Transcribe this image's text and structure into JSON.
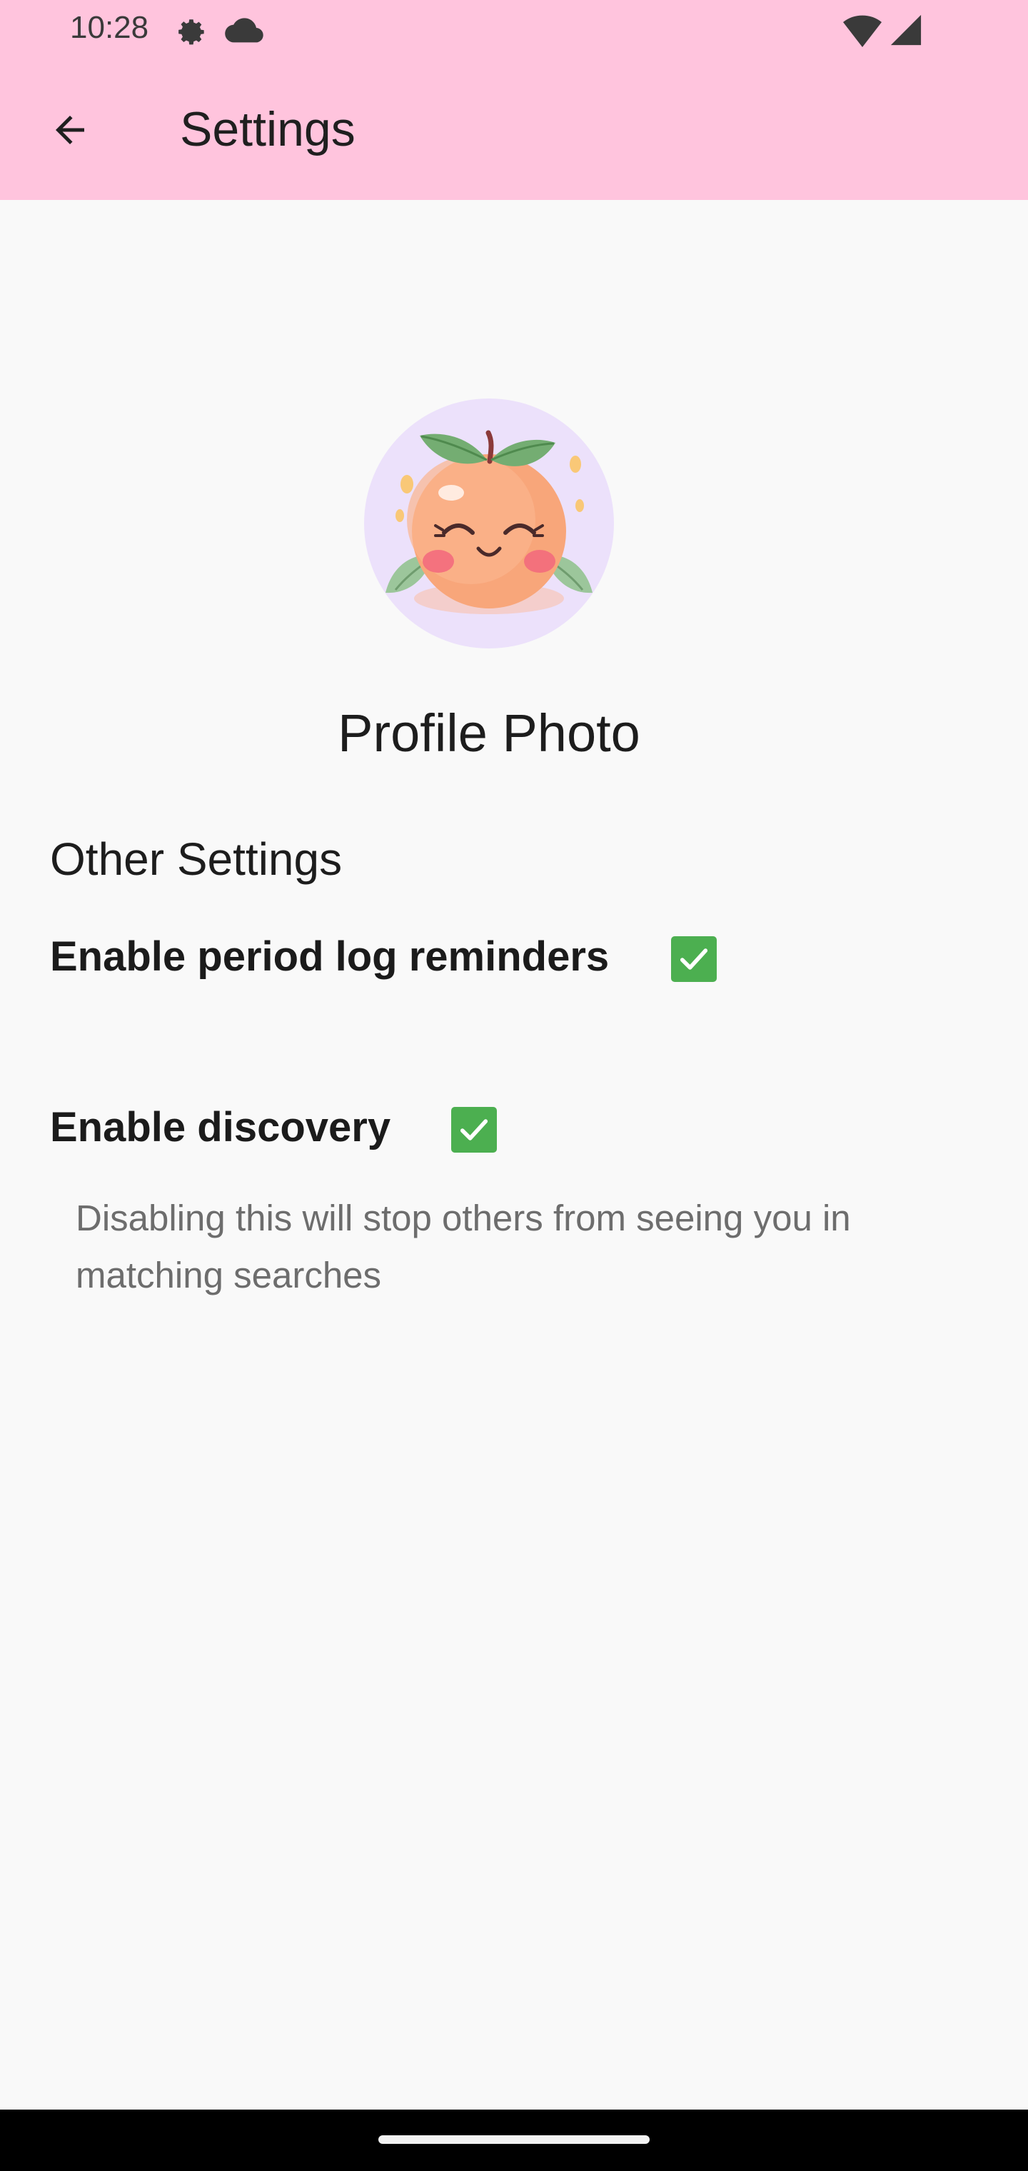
{
  "status_bar": {
    "time": "10:28",
    "icons": [
      "gear-icon",
      "cloud-icon",
      "wifi-icon",
      "signal-icon"
    ]
  },
  "app_bar": {
    "title": "Settings",
    "back_icon": "arrow-left-icon"
  },
  "profile": {
    "label": "Profile Photo",
    "avatar": "peach-character-illustration"
  },
  "other_settings": {
    "title": "Other Settings",
    "items": [
      {
        "label": "Enable period log reminders",
        "checked": true
      },
      {
        "label": "Enable discovery",
        "checked": true,
        "description": "Disabling this will stop others from seeing you in matching searches"
      }
    ]
  },
  "colors": {
    "app_bar": "#ffc4dd",
    "background": "#f9f9f9",
    "checkbox": "#4caf50",
    "avatar_bg": "#ece1fb"
  }
}
